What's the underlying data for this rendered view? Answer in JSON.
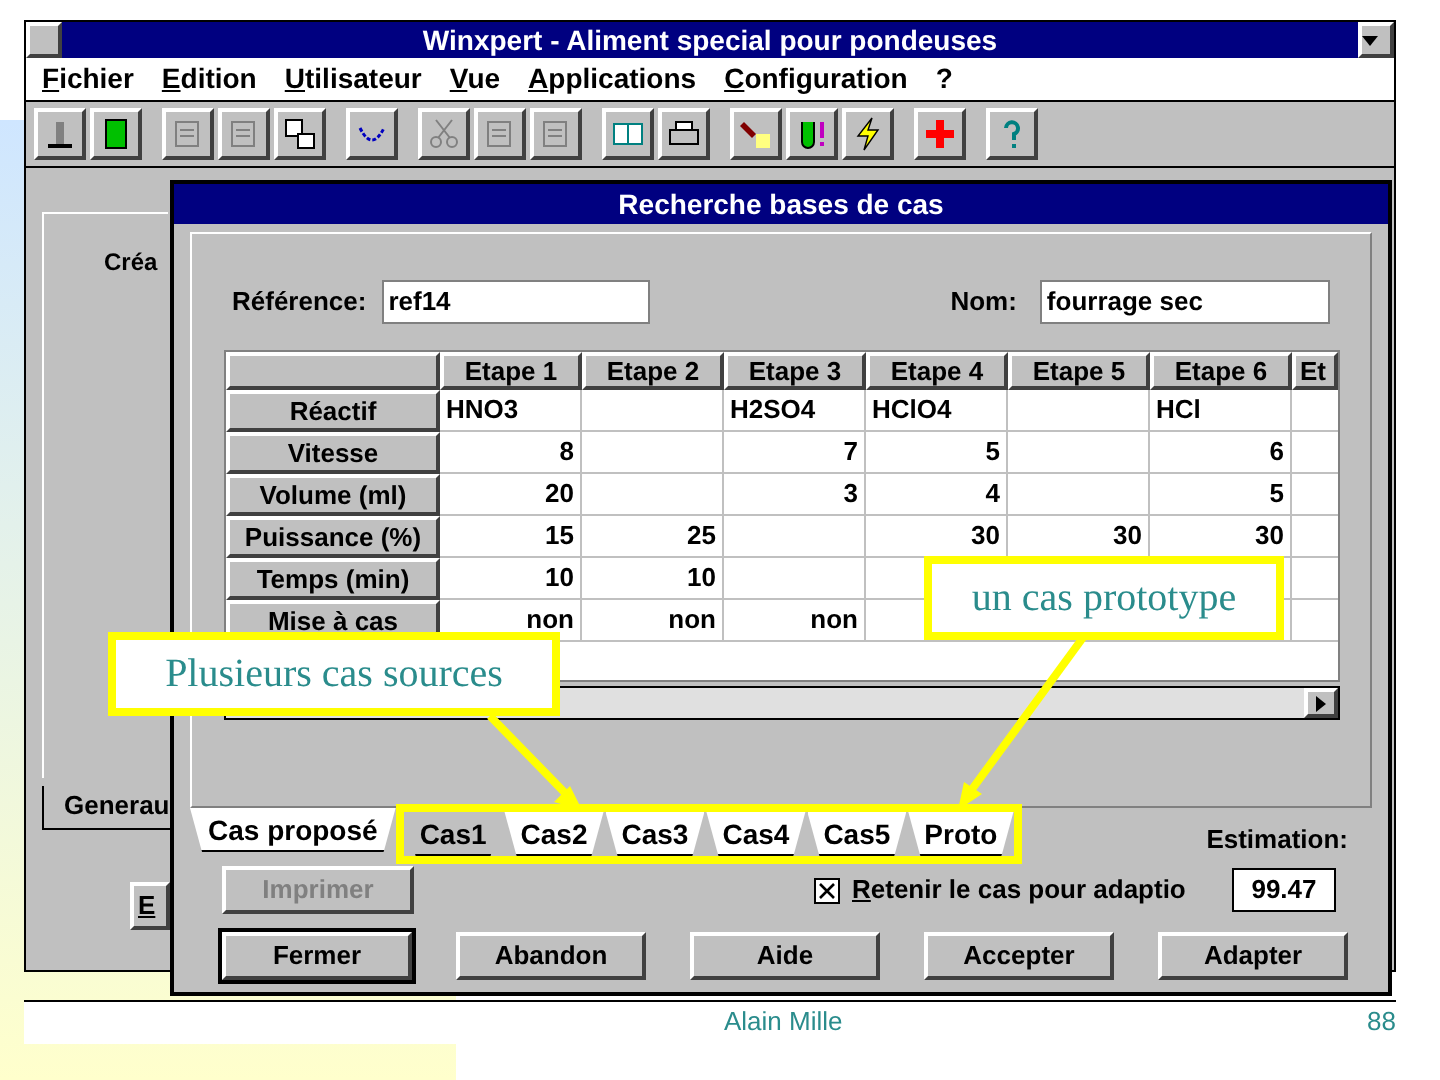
{
  "window": {
    "title": "Winxpert - Aliment special pour pondeuses"
  },
  "menu": [
    "Fichier",
    "Edition",
    "Utilisateur",
    "Vue",
    "Applications",
    "Configuration",
    "?"
  ],
  "background_window": {
    "panel_label": "Créa",
    "tab": "Generau",
    "button": "E"
  },
  "dialog": {
    "title": "Recherche bases de cas",
    "reference_label": "Référence:",
    "reference": "ref14",
    "name_label": "Nom:",
    "name": "fourrage sec",
    "table": {
      "columns": [
        "Etape 1",
        "Etape 2",
        "Etape 3",
        "Etape 4",
        "Etape 5",
        "Etape 6",
        "Et"
      ],
      "rows": [
        {
          "label": "Réactif",
          "kind": "text",
          "cells": [
            "HNO3",
            null,
            "H2SO4",
            "HClO4",
            null,
            "HCl"
          ]
        },
        {
          "label": "Vitesse",
          "kind": "number",
          "cells": [
            "8",
            null,
            "7",
            "5",
            null,
            "6"
          ]
        },
        {
          "label": "Volume (ml)",
          "kind": "number",
          "cells": [
            "20",
            null,
            "3",
            "4",
            null,
            "5"
          ]
        },
        {
          "label": "Puissance (%)",
          "kind": "number",
          "cells": [
            "15",
            "25",
            null,
            "30",
            "30",
            "30"
          ]
        },
        {
          "label": "Temps (min)",
          "kind": "number",
          "cells": [
            "10",
            "10",
            null,
            null,
            null,
            null
          ]
        },
        {
          "label": "Mise à cas",
          "kind": "number",
          "cells": [
            "non",
            "non",
            "non",
            null,
            null,
            null
          ]
        }
      ]
    },
    "tabs": [
      {
        "label": "Cas proposé",
        "selected": false
      },
      {
        "label": "Cas1",
        "selected": true
      },
      {
        "label": "Cas2",
        "selected": false
      },
      {
        "label": "Cas3",
        "selected": false
      },
      {
        "label": "Cas4",
        "selected": false
      },
      {
        "label": "Cas5",
        "selected": false
      },
      {
        "label": "Proto",
        "selected": false
      }
    ],
    "estimation_label": "Estimation:",
    "estimation": "99.47",
    "retain": {
      "label": "Retenir le cas pour adaptio",
      "checked": true
    },
    "print_button": {
      "label": "Imprimer",
      "disabled": true
    },
    "buttons": [
      {
        "label": "Fermer",
        "default": true
      },
      {
        "label": "Abandon",
        "default": false
      },
      {
        "label": "Aide",
        "default": false
      },
      {
        "label": "Accepter",
        "default": false
      },
      {
        "label": "Adapter",
        "default": false
      }
    ]
  },
  "callouts": [
    {
      "text": "un cas prototype"
    },
    {
      "text": "Plusieurs cas sources"
    }
  ],
  "footer": {
    "author": "Alain Mille",
    "page": "88"
  }
}
